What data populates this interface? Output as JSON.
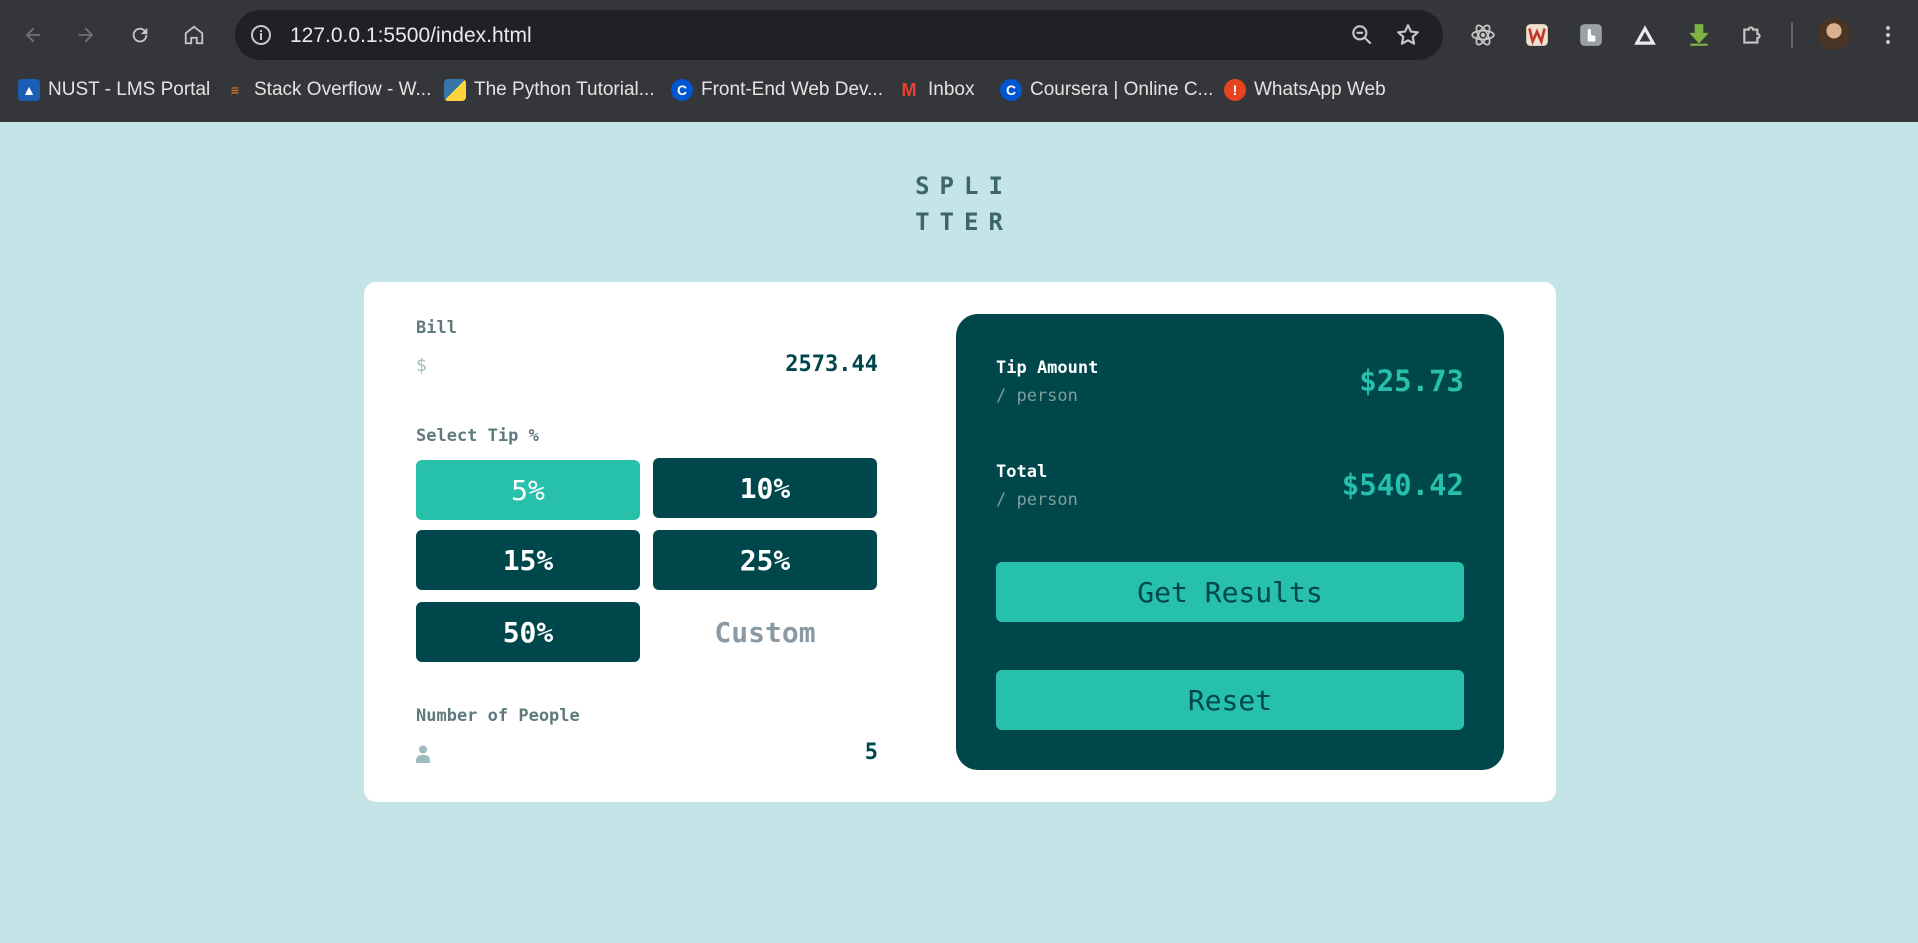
{
  "browser": {
    "url": "127.0.0.1:5500/index.html",
    "bookmarks": [
      {
        "label": "NUST - LMS Portal",
        "icon": "graduation-cap-icon",
        "color": "#1a5fb4"
      },
      {
        "label": "Stack Overflow - W...",
        "icon": "stackoverflow-icon",
        "color": "#f48024"
      },
      {
        "label": "The Python Tutorial...",
        "icon": "python-icon",
        "color": "#3776ab"
      },
      {
        "label": "Front-End Web Dev...",
        "icon": "coursera-icon",
        "color": "#0056d2"
      },
      {
        "label": "Inbox",
        "icon": "gmail-icon",
        "color": "#ea4335"
      },
      {
        "label": "Coursera | Online C...",
        "icon": "coursera-icon",
        "color": "#0056d2"
      },
      {
        "label": "WhatsApp Web",
        "icon": "whatsapp-icon",
        "color": "#e8431f"
      }
    ]
  },
  "app": {
    "logo_line1": "SPLI",
    "logo_line2": "TTER",
    "bill": {
      "label": "Bill",
      "currency_symbol": "$",
      "value": "2573.44"
    },
    "tip": {
      "label": "Select Tip %",
      "options": [
        "5%",
        "10%",
        "15%",
        "25%",
        "50%"
      ],
      "selected": "5%",
      "custom_placeholder": "Custom"
    },
    "people": {
      "label": "Number of People",
      "value": "5"
    },
    "results": {
      "tip_amount": {
        "title": "Tip Amount",
        "sub": "/ person",
        "value": "$25.73"
      },
      "total": {
        "title": "Total",
        "sub": "/ person",
        "value": "$540.42"
      }
    },
    "buttons": {
      "get_results": "Get Results",
      "reset": "Reset"
    }
  },
  "colors": {
    "background": "#c5e4e7",
    "dark_cyan": "#00474b",
    "strong_cyan": "#26c0ab"
  }
}
